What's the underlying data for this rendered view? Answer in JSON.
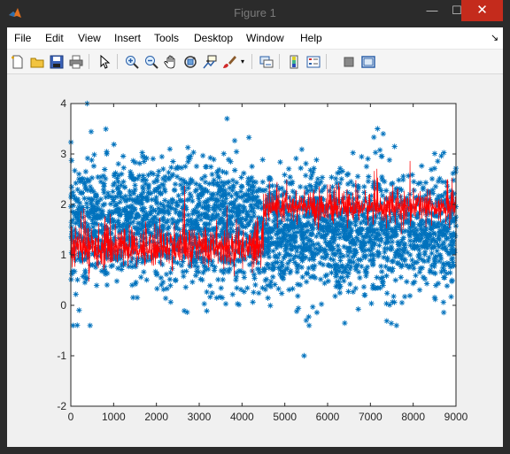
{
  "window": {
    "title": "Figure 1",
    "minimize_glyph": "—",
    "maximize_glyph": "☐",
    "close_glyph": "✕"
  },
  "menubar": {
    "items": [
      "File",
      "Edit",
      "View",
      "Insert",
      "Tools",
      "Desktop",
      "Window",
      "Help"
    ],
    "overflow_glyph": "↘"
  },
  "toolbar": {
    "icons": [
      "new-figure-icon",
      "open-file-icon",
      "save-icon",
      "print-icon",
      "edit-plot-icon",
      "zoom-in-icon",
      "zoom-out-icon",
      "pan-icon",
      "rotate-3d-icon",
      "data-cursor-icon",
      "brush-icon",
      "brush-dropdown-icon",
      "link-plot-icon",
      "insert-colorbar-icon",
      "insert-legend-icon",
      "hide-plot-tools-icon",
      "show-plot-tools-icon"
    ]
  },
  "chart_data": {
    "type": "scatter",
    "title": "",
    "xlabel": "",
    "ylabel": "",
    "xlim": [
      0,
      9000
    ],
    "ylim": [
      -2,
      4
    ],
    "x_ticks": [
      "0",
      "1000",
      "2000",
      "3000",
      "4000",
      "5000",
      "6000",
      "7000",
      "8000",
      "9000"
    ],
    "y_ticks": [
      "-2",
      "-1",
      "0",
      "1",
      "2",
      "3",
      "4"
    ],
    "grid": false,
    "legend": "none",
    "series": [
      {
        "style": "scatter-asterisk",
        "color": "#0072BD",
        "x_range": [
          0,
          9000
        ],
        "segments": [
          {
            "x_from": 0,
            "x_to": 4500,
            "mean": 1.6,
            "spread": 0.6
          },
          {
            "x_from": 4500,
            "x_to": 9000,
            "mean": 1.45,
            "spread": 0.6
          }
        ],
        "notable_points": [
          {
            "x": 380,
            "y": 4.0
          },
          {
            "x": 3650,
            "y": 3.7
          },
          {
            "x": 450,
            "y": -0.4
          },
          {
            "x": 5450,
            "y": -1.0
          },
          {
            "x": 5500,
            "y": -0.3
          },
          {
            "x": 7300,
            "y": 3.4
          }
        ]
      },
      {
        "style": "line",
        "color": "#FF0000",
        "segments": [
          {
            "x_from": 0,
            "x_to": 4500,
            "mean": 1.15,
            "spread": 0.2
          },
          {
            "x_from": 4500,
            "x_to": 9000,
            "mean": 1.95,
            "spread": 0.15
          }
        ]
      }
    ]
  }
}
